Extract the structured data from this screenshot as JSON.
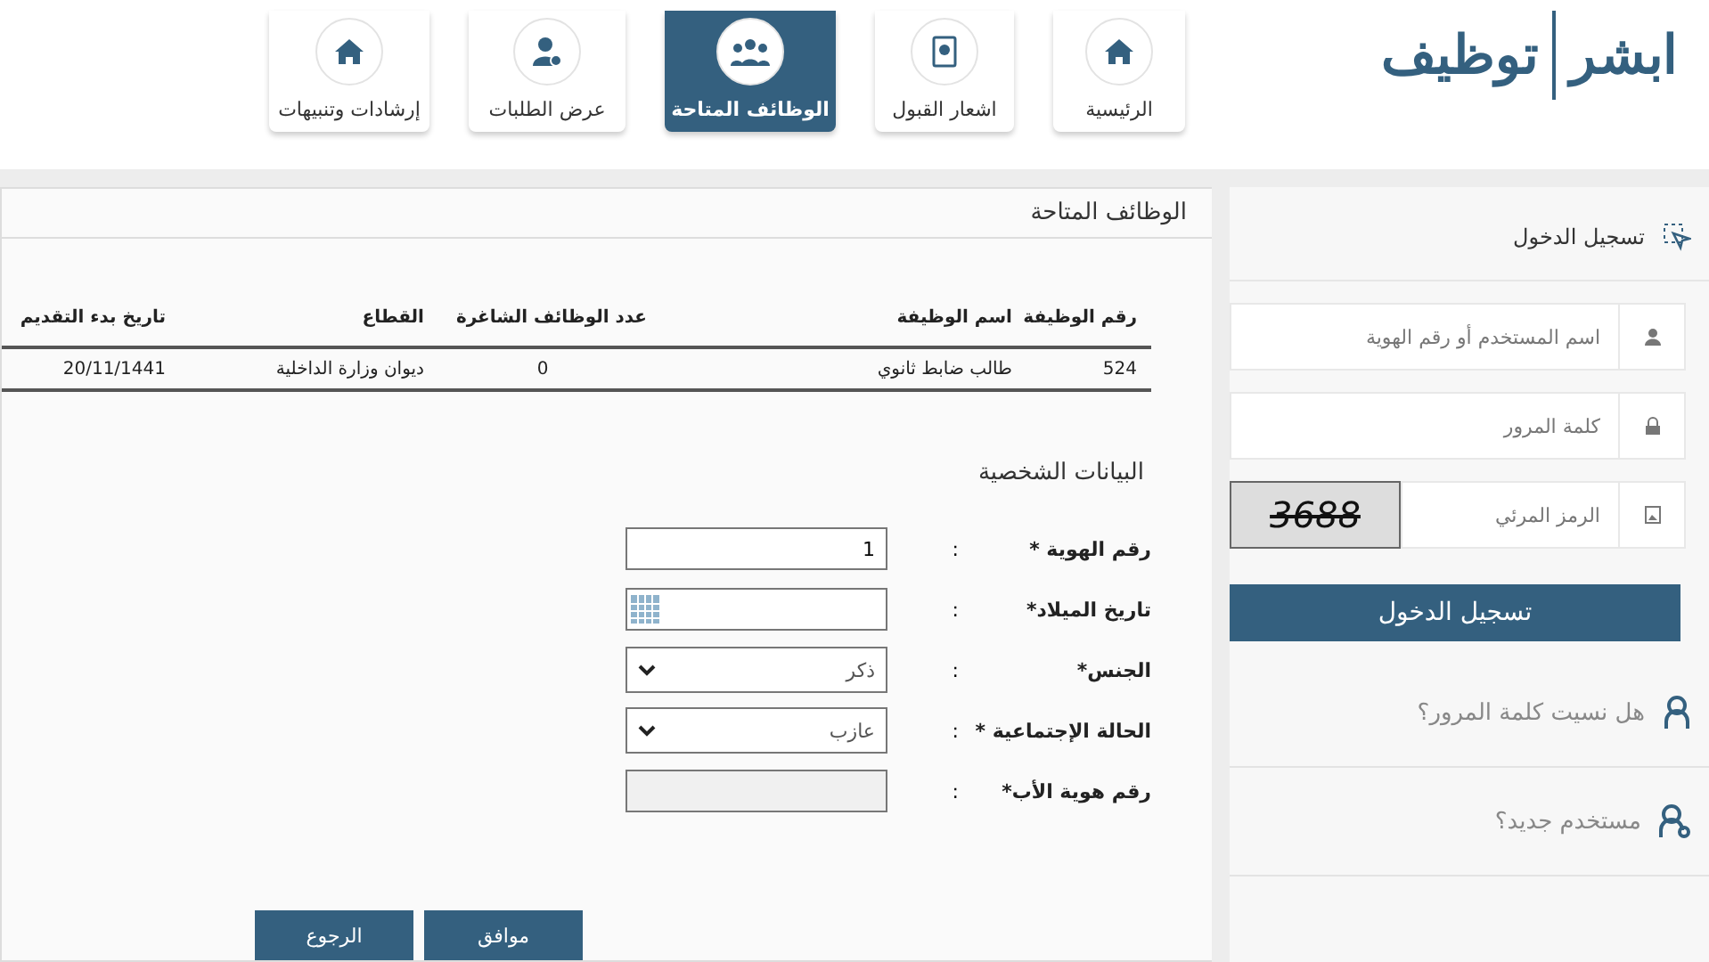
{
  "header": {
    "logo": [
      "ابشر",
      "توظيف"
    ]
  },
  "tabs": [
    {
      "label": "الرئيسية",
      "kind": "home",
      "selected": false
    },
    {
      "label": "اشعار القبول",
      "kind": "doc",
      "selected": false
    },
    {
      "label": "الوظائف المتاحة",
      "kind": "group",
      "selected": true
    },
    {
      "label": "عرض الطلبات",
      "kind": "user",
      "selected": false
    },
    {
      "label": "إرشادات وتنبيهات",
      "kind": "home",
      "selected": false
    }
  ],
  "main": {
    "title": "الوظائف المتاحة",
    "table": {
      "columns": [
        "رقم الوظيفة",
        "اسم الوظيفة",
        "عدد الوظائف الشاغرة",
        "القطاع",
        "تاريخ بدء التقديم"
      ],
      "rows": [
        [
          "524",
          "طالب ضابط ثانوي",
          "0",
          "ديوان وزارة الداخلية",
          "20/11/1441"
        ]
      ]
    },
    "form": {
      "title": "البيانات الشخصية",
      "fields": [
        {
          "label": "رقم الهوية *",
          "kind": "text",
          "value": "1"
        },
        {
          "label": "تاريخ الميلاد*",
          "kind": "date"
        },
        {
          "label": "الجنس*",
          "kind": "select",
          "value": "ذكر"
        },
        {
          "label": "الحالة الإجتماعية *",
          "kind": "select",
          "value": "عازب"
        },
        {
          "label": "رقم هوية الأب*",
          "kind": "disabled"
        }
      ],
      "separator": ":"
    },
    "buttons": [
      "موافق",
      "الرجوع"
    ]
  },
  "login": {
    "title": "تسجيل الدخول",
    "fields": [
      {
        "kind": "user",
        "placeholder": "اسم المستخدم أو رقم الهوية"
      },
      {
        "kind": "lock",
        "placeholder": "كلمة المرور"
      },
      {
        "kind": "captcha",
        "placeholder": "الرمز المرئي",
        "captcha": "3688"
      }
    ],
    "button": "تسجيل الدخول",
    "links": [
      {
        "kind": "forgot",
        "label": "هل نسيت كلمة المرور؟"
      },
      {
        "kind": "new",
        "label": "مستخدم جديد؟"
      }
    ]
  }
}
